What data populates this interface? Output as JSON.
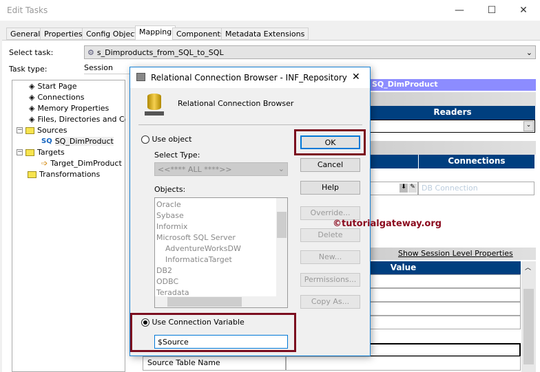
{
  "window": {
    "title": "Edit Tasks",
    "minimize": "—",
    "maximize": "☐",
    "close": "✕"
  },
  "tabs": [
    "General",
    "Properties",
    "Config Object",
    "Mapping",
    "Components",
    "Metadata Extensions"
  ],
  "select_task": {
    "label": "Select task:",
    "value": "s_Dimproducts_from_SQL_to_SQL"
  },
  "task_type": {
    "label": "Task type:",
    "value": "Session"
  },
  "tree": {
    "items": [
      "Start Page",
      "Connections",
      "Memory Properties",
      "Files, Directories and Commands",
      "Sources",
      "SQ_DimProduct",
      "Targets",
      "Target_DimProduct",
      "Transformations"
    ],
    "sq_badge": "SQ"
  },
  "right": {
    "selected": "SQ_DimProduct",
    "readers_header": "Readers",
    "connections_header": "Connections",
    "db_connection_placeholder": "DB Connection",
    "show_session": "Show Session Level Properties",
    "value_header": "Value",
    "source_table_name": "Source Table Name"
  },
  "dialog": {
    "title": "Relational Connection Browser - INF_Repository",
    "heading": "Relational Connection Browser",
    "use_object": "Use object",
    "select_type_label": "Select Type:",
    "select_type_value": "<<**** ALL ****>>",
    "objects_label": "Objects:",
    "objects": [
      "Oracle",
      "Sybase",
      "Informix",
      "Microsoft SQL Server",
      "AdventureWorksDW",
      "InformaticaTarget",
      "DB2",
      "ODBC",
      "Teradata"
    ],
    "use_conn_var": "Use Connection Variable",
    "conn_var_value": "$Source",
    "buttons": {
      "ok": "OK",
      "cancel": "Cancel",
      "help": "Help",
      "override": "Override...",
      "delete": "Delete",
      "new": "New...",
      "permissions": "Permissions...",
      "copy_as": "Copy As..."
    },
    "close": "✕"
  },
  "watermark": "©tutorialgateway.org"
}
